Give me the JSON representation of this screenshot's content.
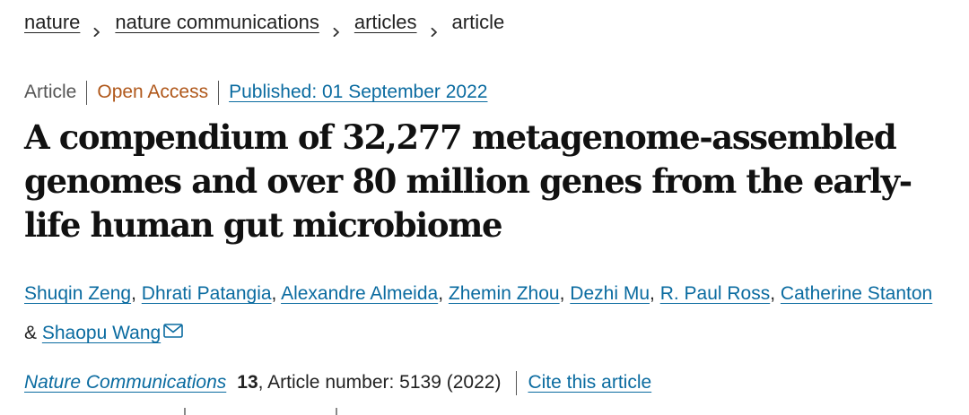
{
  "breadcrumb": {
    "items": [
      {
        "label": "nature"
      },
      {
        "label": "nature communications"
      },
      {
        "label": "articles"
      }
    ],
    "current": "article"
  },
  "meta": {
    "type": "Article",
    "access": "Open Access",
    "published": "Published: 01 September 2022"
  },
  "title": "A compendium of 32,277 metagenome-assembled genomes and over 80 million genes from the early-life human gut microbiome",
  "authors": {
    "list": [
      "Shuqin Zeng",
      "Dhrati Patangia",
      "Alexandre Almeida",
      "Zhemin Zhou",
      "Dezhi Mu",
      "R. Paul Ross",
      "Catherine Stanton",
      "Shaopu Wang"
    ],
    "comma": ",",
    "ampersand": "&"
  },
  "citation": {
    "journal": "Nature Communications",
    "volume": "13",
    "details": ", Article number: 5139 (2022)",
    "cite_link": "Cite this article"
  },
  "colors": {
    "link": "#0a6ba0",
    "open_access": "#b0581b",
    "text": "#222222"
  },
  "icons": {
    "breadcrumb_separator": "chevron-right-icon",
    "corresponding_author": "mail-icon"
  }
}
